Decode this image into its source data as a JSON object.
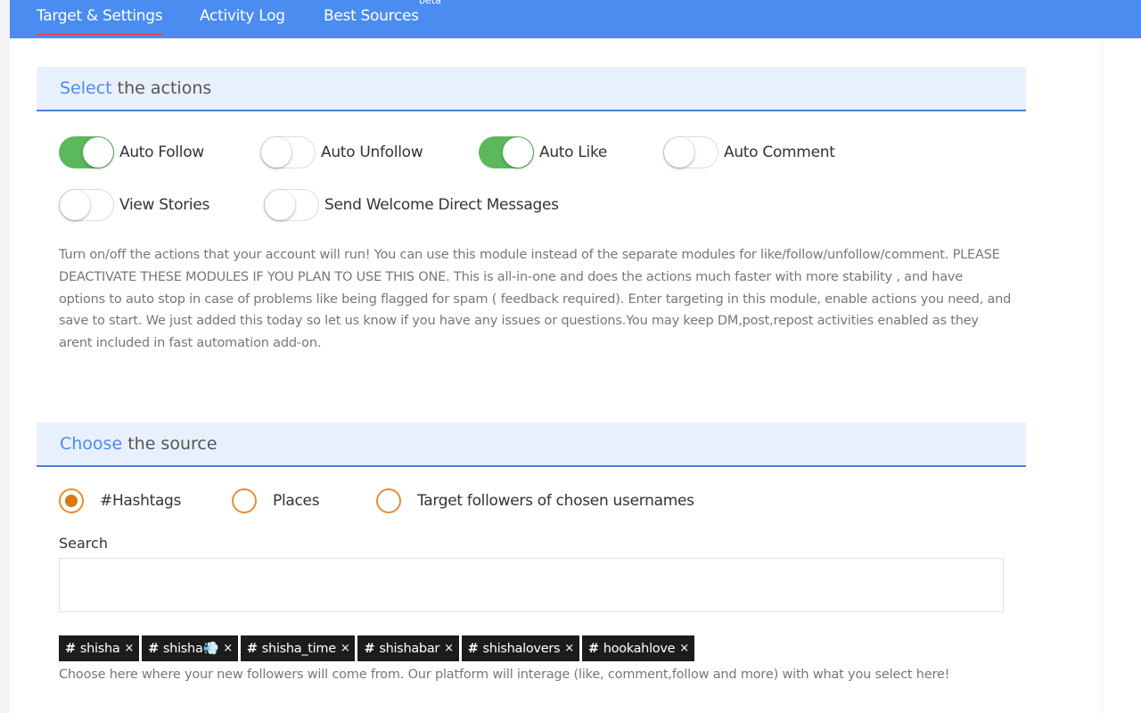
{
  "nav": {
    "tabs": [
      {
        "label": "Target & Settings",
        "active": true
      },
      {
        "label": "Activity Log",
        "active": false
      },
      {
        "label": "Best Sources",
        "active": false,
        "badge": "beta"
      }
    ]
  },
  "actions_section": {
    "title_accent": "Select",
    "title_rest": " the actions",
    "toggles": [
      {
        "label": "Auto Follow",
        "on": true
      },
      {
        "label": "Auto Unfollow",
        "on": false
      },
      {
        "label": "Auto Like",
        "on": true
      },
      {
        "label": "Auto Comment",
        "on": false
      },
      {
        "label": "View Stories",
        "on": false
      },
      {
        "label": "Send Welcome Direct Messages",
        "on": false
      }
    ],
    "description": "Turn on/off the actions that your account will run! You can use this module instead of the separate modules for like/follow/unfollow/comment. PLEASE DEACTIVATE THESE MODULES IF YOU PLAN TO USE THIS ONE. This is all-in-one and does the actions much faster with more stability , and have options to auto stop in case of problems like being flagged for spam ( feedback required). Enter targeting in this module, enable actions you need, and save to start. We just added this today so let us know if you have any issues or questions.You may keep DM,post,repost activities enabled as they arent included in fast automation add-on."
  },
  "source_section": {
    "title_accent": "Choose",
    "title_rest": " the source",
    "options": [
      {
        "label": "#Hashtags",
        "selected": true
      },
      {
        "label": "Places",
        "selected": false
      },
      {
        "label": "Target followers of chosen usernames",
        "selected": false
      }
    ],
    "search_label": "Search",
    "search_value": "",
    "tags": [
      {
        "hash": "#",
        "text": "shisha",
        "remove": "×"
      },
      {
        "hash": "#",
        "text": "shisha💨",
        "remove": "×"
      },
      {
        "hash": "#",
        "text": "shisha_time",
        "remove": "×"
      },
      {
        "hash": "#",
        "text": "shishabar",
        "remove": "×"
      },
      {
        "hash": "#",
        "text": "shishalovers",
        "remove": "×"
      },
      {
        "hash": "#",
        "text": "hookahlove",
        "remove": "×"
      }
    ],
    "note": "Choose here where your new followers will come from. Our platform will interage (like, comment,follow and more) with what you select here!"
  },
  "colors": {
    "nav_bg": "#4a8cf0",
    "active_tab_underline": "#e8454a",
    "header_bg": "#e9f0fd",
    "header_border": "#4a7fd8",
    "toggle_on": "#5cb85c",
    "radio_accent": "#e0922e",
    "tag_bg": "#1c1c1c"
  }
}
